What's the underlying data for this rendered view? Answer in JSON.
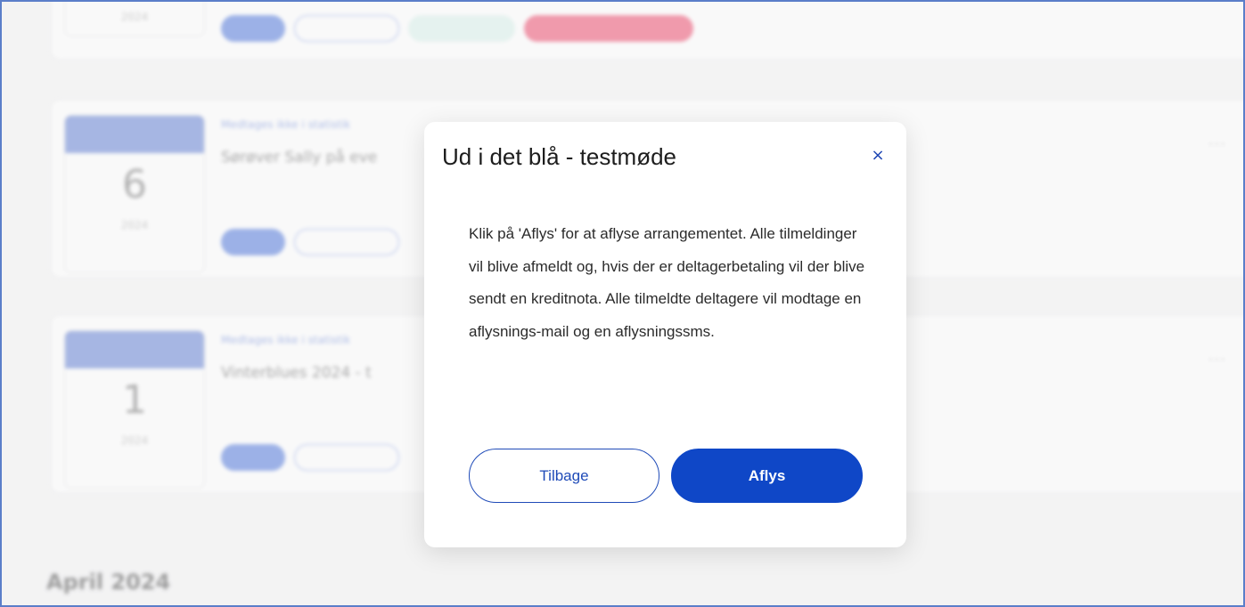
{
  "background": {
    "events": [
      {
        "month": "",
        "day": "",
        "year": "2024",
        "kicker": "",
        "title": "",
        "sub": "",
        "tags": [
          "",
          "",
          "",
          ""
        ],
        "meta": ""
      },
      {
        "month": "",
        "day": "6",
        "year": "2024",
        "kicker": "Medtages ikke i statistik",
        "title": "Sørøver Sally på eve",
        "sub": "",
        "tags": [
          "",
          ""
        ],
        "meta": "",
        "dots": "..."
      },
      {
        "month": "",
        "day": "1",
        "year": "2024",
        "kicker": "Medtages ikke i statistik",
        "title": "Vinterblues 2024 - t",
        "sub": "",
        "tags": [
          "",
          ""
        ],
        "meta": "",
        "dots": "..."
      }
    ],
    "month_heading": "April 2024"
  },
  "modal": {
    "title": "Ud i det blå - testmøde",
    "close_icon": "×",
    "body": "Klik på 'Aflys' for at aflyse arrangementet. Alle tilmeldinger vil blive afmeldt og, hvis der er deltagerbetaling vil der blive sendt en kreditnota. Alle tilmeldte deltagere vil mod­tage en aflysnings-mail og en aflysnings­sms.",
    "back_label": "Tilbage",
    "cancel_label": "Aflys"
  },
  "colors": {
    "accent": "#0f47c7",
    "frame": "#5b7ec9"
  }
}
